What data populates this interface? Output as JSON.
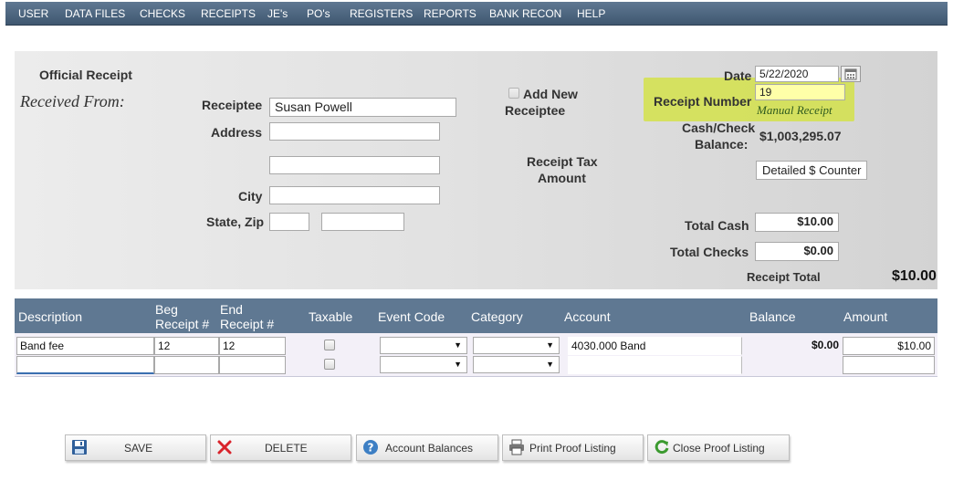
{
  "menu": [
    "USER",
    "DATA FILES",
    "CHECKS",
    "RECEIPTS",
    "JE's",
    "PO's",
    "REGISTERS",
    "REPORTS",
    "BANK RECON",
    "HELP"
  ],
  "form": {
    "official_receipt": "Official Receipt",
    "received_from": "Received From:",
    "receiptee_label": "Receiptee",
    "receiptee_value": "Susan Powell",
    "address_label": "Address",
    "address1": "",
    "address2": "",
    "city_label": "City",
    "city": "",
    "state_zip_label": "State, Zip",
    "state": "",
    "zip": "",
    "add_new_line1": "Add New",
    "add_new_line2": "Receiptee",
    "receipt_tax_line1": "Receipt Tax",
    "receipt_tax_line2": "Amount",
    "date_label": "Date",
    "date_value": "5/22/2020",
    "receipt_number_label": "Receipt Number",
    "receipt_number_value": "19",
    "manual_receipt": "Manual Receipt",
    "cash_check_line1": "Cash/Check",
    "cash_check_line2": "Balance:",
    "cash_check_value": "$1,003,295.07",
    "detailed_counter": "Detailed $ Counter",
    "total_cash_label": "Total Cash",
    "total_cash_value": "$10.00",
    "total_checks_label": "Total Checks",
    "total_checks_value": "$0.00",
    "receipt_total_label": "Receipt Total",
    "receipt_total_value": "$10.00"
  },
  "grid": {
    "columns": {
      "description": "Description",
      "beg_receipt_1": "Beg",
      "beg_receipt_2": "Receipt #",
      "end_receipt_1": "End",
      "end_receipt_2": "Receipt #",
      "taxable": "Taxable",
      "event_code": "Event Code",
      "category": "Category",
      "account": "Account",
      "balance": "Balance",
      "amount": "Amount"
    },
    "rows": [
      {
        "description": "Band fee",
        "beg": "12",
        "end": "12",
        "account": "4030.000 Band",
        "balance": "$0.00",
        "amount": "$10.00"
      },
      {
        "description": "",
        "beg": "",
        "end": "",
        "account": "",
        "balance": "",
        "amount": ""
      }
    ]
  },
  "footer": {
    "save": "SAVE",
    "delete": "DELETE",
    "account_balances": "Account Balances",
    "print_proof": "Print Proof Listing",
    "close_proof": "Close Proof Listing"
  }
}
